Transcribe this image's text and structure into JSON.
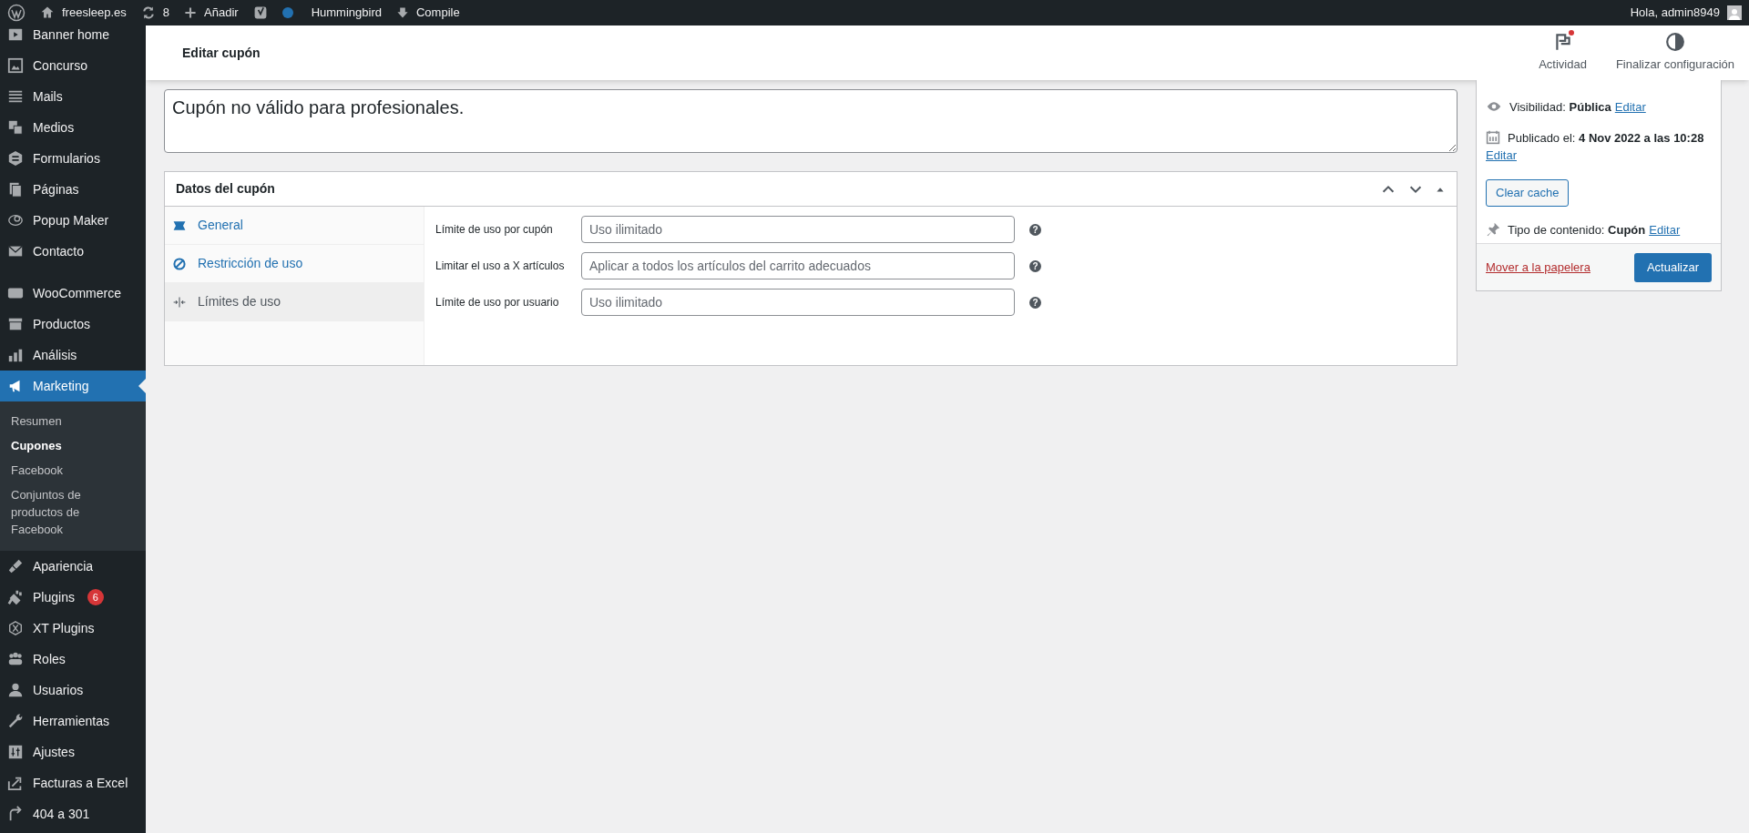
{
  "admin_bar": {
    "items": [
      {
        "kind": "wp-logo"
      },
      {
        "kind": "home",
        "label": "freesleep.es"
      },
      {
        "kind": "updates",
        "label": "8"
      },
      {
        "kind": "new",
        "label": "Añadir"
      },
      {
        "kind": "yoast"
      },
      {
        "kind": "dot",
        "label": "Hummingbird"
      },
      {
        "kind": "compile",
        "label": "Compile"
      }
    ],
    "greeting": "Hola, admin8949"
  },
  "sidebar": {
    "groups": [
      [
        {
          "label": "Banner home",
          "selected": false
        },
        {
          "label": "Concurso",
          "selected": false
        },
        {
          "label": "Mails",
          "selected": false
        },
        {
          "label": "Medios",
          "selected": false
        },
        {
          "label": "Formularios",
          "selected": false
        },
        {
          "label": "Páginas",
          "selected": false
        },
        {
          "label": "Popup Maker",
          "selected": false
        },
        {
          "label": "Contacto",
          "selected": false
        }
      ],
      [
        {
          "label": "WooCommerce",
          "selected": false
        },
        {
          "label": "Productos",
          "selected": false
        },
        {
          "label": "Análisis",
          "selected": false
        },
        {
          "label": "Marketing",
          "selected": true,
          "children": [
            {
              "label": "Resumen",
              "selected": false
            },
            {
              "label": "Cupones",
              "selected": true
            },
            {
              "label": "Facebook",
              "selected": false
            },
            {
              "label": "Conjuntos de productos de Facebook",
              "selected": false
            }
          ]
        }
      ],
      [
        {
          "label": "Apariencia",
          "selected": false
        },
        {
          "label": "Plugins",
          "selected": false,
          "badge": "6"
        },
        {
          "label": "XT Plugins",
          "selected": false
        },
        {
          "label": "Roles",
          "selected": false
        },
        {
          "label": "Usuarios",
          "selected": false
        },
        {
          "label": "Herramientas",
          "selected": false
        },
        {
          "label": "Ajustes",
          "selected": false
        },
        {
          "label": "Facturas a Excel",
          "selected": false
        },
        {
          "label": "404 a 301",
          "selected": false
        }
      ]
    ]
  },
  "header": {
    "title": "Editar cupón",
    "actions": [
      {
        "kind": "activity",
        "label": "Actividad",
        "notification": true
      },
      {
        "kind": "setup",
        "label": "Finalizar configuración",
        "notification": false
      }
    ]
  },
  "description": {
    "value": "Cupón no válido para profesionales."
  },
  "coupon_data": {
    "title": "Datos del cupón",
    "tabs": [
      {
        "label": "General",
        "selected": false
      },
      {
        "label": "Restricción de uso",
        "selected": false
      },
      {
        "label": "Límites de uso",
        "selected": true
      }
    ],
    "fields": [
      {
        "label": "Límite de uso por cupón",
        "placeholder": "Uso ilimitado",
        "help": "?"
      },
      {
        "label": "Limitar el uso a X artículos",
        "placeholder": "Aplicar a todos los artículos del carrito adecuados",
        "help": "?"
      },
      {
        "label": "Límite de uso por usuario",
        "placeholder": "Uso ilimitado",
        "help": "?"
      }
    ]
  },
  "publish": {
    "rows": [
      {
        "kind": "visibility",
        "label": "Visibilidad:",
        "value": "Pública",
        "link": "Editar"
      },
      {
        "kind": "date",
        "label": "Publicado el:",
        "value": "4 Nov 2022 a las 10:28",
        "link": "Editar"
      },
      {
        "kind": "button",
        "label": "Clear cache"
      },
      {
        "kind": "type",
        "label": "Tipo de contenido:",
        "value": "Cupón",
        "link": "Editar"
      }
    ],
    "trash": "Mover a la papelera",
    "update": "Actualizar"
  }
}
